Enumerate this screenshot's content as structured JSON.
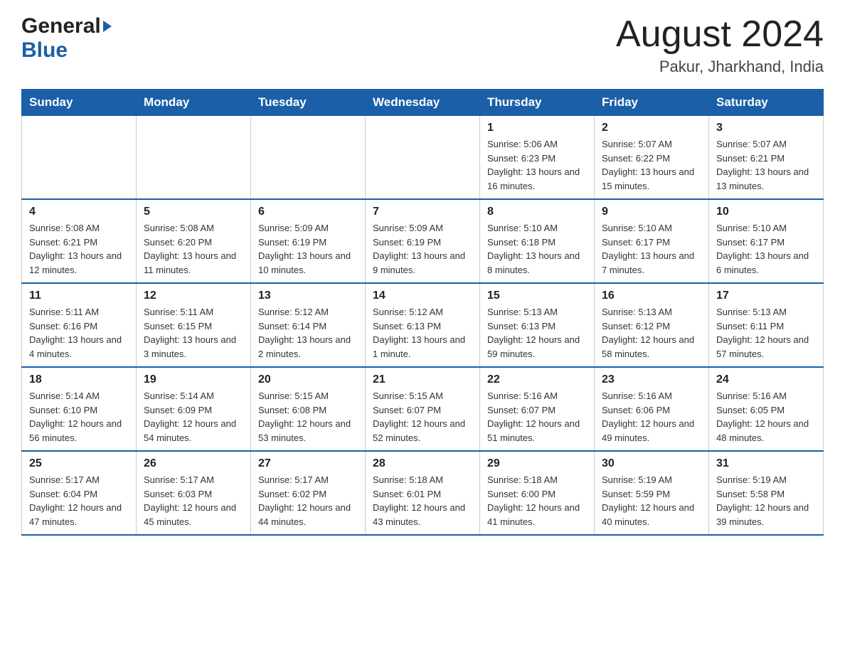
{
  "header": {
    "logo_general": "General",
    "logo_blue": "Blue",
    "month_title": "August 2024",
    "location": "Pakur, Jharkhand, India"
  },
  "days_of_week": [
    "Sunday",
    "Monday",
    "Tuesday",
    "Wednesday",
    "Thursday",
    "Friday",
    "Saturday"
  ],
  "weeks": [
    {
      "days": [
        {
          "num": "",
          "info": ""
        },
        {
          "num": "",
          "info": ""
        },
        {
          "num": "",
          "info": ""
        },
        {
          "num": "",
          "info": ""
        },
        {
          "num": "1",
          "info": "Sunrise: 5:06 AM\nSunset: 6:23 PM\nDaylight: 13 hours and 16 minutes."
        },
        {
          "num": "2",
          "info": "Sunrise: 5:07 AM\nSunset: 6:22 PM\nDaylight: 13 hours and 15 minutes."
        },
        {
          "num": "3",
          "info": "Sunrise: 5:07 AM\nSunset: 6:21 PM\nDaylight: 13 hours and 13 minutes."
        }
      ]
    },
    {
      "days": [
        {
          "num": "4",
          "info": "Sunrise: 5:08 AM\nSunset: 6:21 PM\nDaylight: 13 hours and 12 minutes."
        },
        {
          "num": "5",
          "info": "Sunrise: 5:08 AM\nSunset: 6:20 PM\nDaylight: 13 hours and 11 minutes."
        },
        {
          "num": "6",
          "info": "Sunrise: 5:09 AM\nSunset: 6:19 PM\nDaylight: 13 hours and 10 minutes."
        },
        {
          "num": "7",
          "info": "Sunrise: 5:09 AM\nSunset: 6:19 PM\nDaylight: 13 hours and 9 minutes."
        },
        {
          "num": "8",
          "info": "Sunrise: 5:10 AM\nSunset: 6:18 PM\nDaylight: 13 hours and 8 minutes."
        },
        {
          "num": "9",
          "info": "Sunrise: 5:10 AM\nSunset: 6:17 PM\nDaylight: 13 hours and 7 minutes."
        },
        {
          "num": "10",
          "info": "Sunrise: 5:10 AM\nSunset: 6:17 PM\nDaylight: 13 hours and 6 minutes."
        }
      ]
    },
    {
      "days": [
        {
          "num": "11",
          "info": "Sunrise: 5:11 AM\nSunset: 6:16 PM\nDaylight: 13 hours and 4 minutes."
        },
        {
          "num": "12",
          "info": "Sunrise: 5:11 AM\nSunset: 6:15 PM\nDaylight: 13 hours and 3 minutes."
        },
        {
          "num": "13",
          "info": "Sunrise: 5:12 AM\nSunset: 6:14 PM\nDaylight: 13 hours and 2 minutes."
        },
        {
          "num": "14",
          "info": "Sunrise: 5:12 AM\nSunset: 6:13 PM\nDaylight: 13 hours and 1 minute."
        },
        {
          "num": "15",
          "info": "Sunrise: 5:13 AM\nSunset: 6:13 PM\nDaylight: 12 hours and 59 minutes."
        },
        {
          "num": "16",
          "info": "Sunrise: 5:13 AM\nSunset: 6:12 PM\nDaylight: 12 hours and 58 minutes."
        },
        {
          "num": "17",
          "info": "Sunrise: 5:13 AM\nSunset: 6:11 PM\nDaylight: 12 hours and 57 minutes."
        }
      ]
    },
    {
      "days": [
        {
          "num": "18",
          "info": "Sunrise: 5:14 AM\nSunset: 6:10 PM\nDaylight: 12 hours and 56 minutes."
        },
        {
          "num": "19",
          "info": "Sunrise: 5:14 AM\nSunset: 6:09 PM\nDaylight: 12 hours and 54 minutes."
        },
        {
          "num": "20",
          "info": "Sunrise: 5:15 AM\nSunset: 6:08 PM\nDaylight: 12 hours and 53 minutes."
        },
        {
          "num": "21",
          "info": "Sunrise: 5:15 AM\nSunset: 6:07 PM\nDaylight: 12 hours and 52 minutes."
        },
        {
          "num": "22",
          "info": "Sunrise: 5:16 AM\nSunset: 6:07 PM\nDaylight: 12 hours and 51 minutes."
        },
        {
          "num": "23",
          "info": "Sunrise: 5:16 AM\nSunset: 6:06 PM\nDaylight: 12 hours and 49 minutes."
        },
        {
          "num": "24",
          "info": "Sunrise: 5:16 AM\nSunset: 6:05 PM\nDaylight: 12 hours and 48 minutes."
        }
      ]
    },
    {
      "days": [
        {
          "num": "25",
          "info": "Sunrise: 5:17 AM\nSunset: 6:04 PM\nDaylight: 12 hours and 47 minutes."
        },
        {
          "num": "26",
          "info": "Sunrise: 5:17 AM\nSunset: 6:03 PM\nDaylight: 12 hours and 45 minutes."
        },
        {
          "num": "27",
          "info": "Sunrise: 5:17 AM\nSunset: 6:02 PM\nDaylight: 12 hours and 44 minutes."
        },
        {
          "num": "28",
          "info": "Sunrise: 5:18 AM\nSunset: 6:01 PM\nDaylight: 12 hours and 43 minutes."
        },
        {
          "num": "29",
          "info": "Sunrise: 5:18 AM\nSunset: 6:00 PM\nDaylight: 12 hours and 41 minutes."
        },
        {
          "num": "30",
          "info": "Sunrise: 5:19 AM\nSunset: 5:59 PM\nDaylight: 12 hours and 40 minutes."
        },
        {
          "num": "31",
          "info": "Sunrise: 5:19 AM\nSunset: 5:58 PM\nDaylight: 12 hours and 39 minutes."
        }
      ]
    }
  ]
}
